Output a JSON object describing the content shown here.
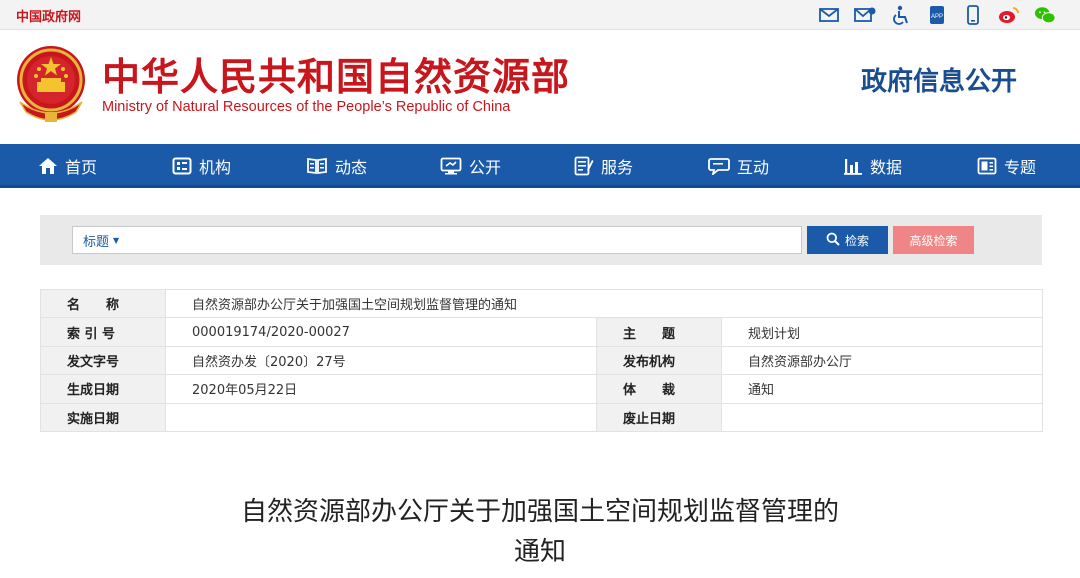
{
  "topbar": {
    "site_link": "中国政府网",
    "icons": [
      "mail-icon",
      "mail-subscribe-icon",
      "accessibility-icon",
      "app-icon",
      "mobile-icon",
      "weibo-icon",
      "wechat-icon"
    ],
    "app_label": "APP"
  },
  "header": {
    "title_cn": "中华人民共和国自然资源部",
    "title_en": "Ministry of Natural Resources of the People’s Republic of China",
    "right_title": "政府信息公开"
  },
  "nav": {
    "items": [
      {
        "label": "首页",
        "icon": "home-icon"
      },
      {
        "label": "机构",
        "icon": "organization-icon"
      },
      {
        "label": "动态",
        "icon": "news-icon"
      },
      {
        "label": "公开",
        "icon": "disclosure-icon"
      },
      {
        "label": "服务",
        "icon": "service-icon"
      },
      {
        "label": "互动",
        "icon": "interaction-icon"
      },
      {
        "label": "数据",
        "icon": "data-icon"
      },
      {
        "label": "专题",
        "icon": "topic-icon"
      }
    ]
  },
  "search": {
    "field_selected": "标题",
    "input_value": "",
    "search_button": "检索",
    "advanced_button": "高级检索"
  },
  "meta": {
    "name_label": "名　　称",
    "name_value": "自然资源部办公厅关于加强国土空间规划监督管理的通知",
    "index_label": "索 引 号",
    "index_value": "000019174/2020-00027",
    "subject_label": "主　　题",
    "subject_value": "规划计划",
    "docno_label": "发文字号",
    "docno_value": "自然资办发〔2020〕27号",
    "issuer_label": "发布机构",
    "issuer_value": "自然资源部办公厅",
    "date_label": "生成日期",
    "date_value": "2020年05月22日",
    "genre_label": "体　　裁",
    "genre_value": "通知",
    "effective_label": "实施日期",
    "effective_value": "",
    "expiry_label": "废止日期",
    "expiry_value": ""
  },
  "document": {
    "title_line1": "自然资源部办公厅关于加强国土空间规划监督管理的",
    "title_line2": "通知"
  },
  "colors": {
    "brand_red": "#c8161d",
    "nav_blue": "#1b5aa8",
    "title_blue": "#1a4d8f",
    "advanced_button": "#ef8585"
  }
}
